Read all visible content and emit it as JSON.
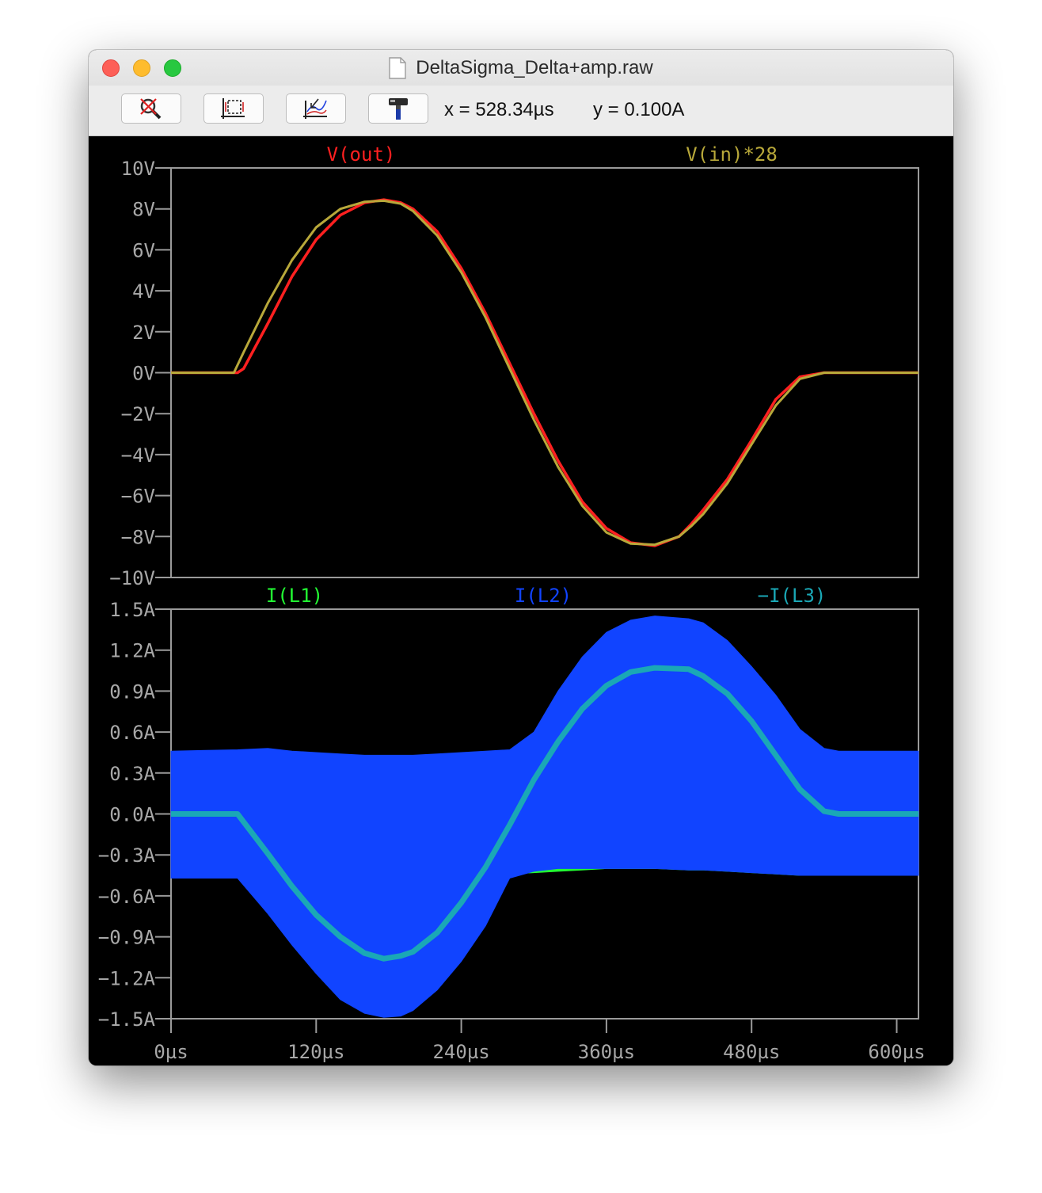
{
  "window": {
    "title": "DeltaSigma_Delta+amp.raw"
  },
  "toolbar": {
    "buttons": [
      {
        "name": "zoom-cancel-button",
        "icon": "zoom-cancel-icon"
      },
      {
        "name": "autorange-button",
        "icon": "autorange-icon"
      },
      {
        "name": "add-plot-button",
        "icon": "add-plot-icon"
      },
      {
        "name": "hammer-button",
        "icon": "hammer-icon"
      }
    ],
    "x_readout": "x = 528.34µs",
    "y_readout": "y = 0.100A"
  },
  "colors": {
    "background": "#000000",
    "grid": "#9a9a9a",
    "axis_text": "#a8a8a8",
    "vout": "#ff2020",
    "vin": "#b8a83a",
    "il1": "#22ff33",
    "il2": "#1144ff",
    "il3": "#1aa8b6"
  },
  "chart_data": [
    {
      "type": "line",
      "legend": [
        "V(out)",
        "V(in)*28"
      ],
      "ylim": [
        -10,
        10
      ],
      "xlim": [
        0,
        600
      ],
      "yticks": [
        "10V",
        "8V",
        "6V",
        "4V",
        "2V",
        "0V",
        "−2V",
        "−4V",
        "−6V",
        "−8V",
        "−10V"
      ],
      "series": [
        {
          "name": "V(out)",
          "x": [
            0,
            52,
            55,
            60,
            80,
            100,
            120,
            140,
            160,
            176,
            190,
            200,
            220,
            240,
            260,
            280,
            300,
            320,
            340,
            360,
            380,
            400,
            420,
            430,
            440,
            460,
            480,
            500,
            520,
            540,
            550,
            552,
            560,
            600,
            618
          ],
          "values": [
            0,
            0,
            0,
            0.2,
            2.4,
            4.7,
            6.5,
            7.7,
            8.3,
            8.45,
            8.3,
            8.0,
            6.9,
            5.1,
            2.9,
            0.45,
            -2.0,
            -4.3,
            -6.3,
            -7.6,
            -8.3,
            -8.45,
            -8.0,
            -7.4,
            -6.7,
            -5.2,
            -3.3,
            -1.3,
            -0.2,
            0,
            0,
            0,
            0,
            0,
            0
          ]
        },
        {
          "name": "V(in)*28",
          "x": [
            0,
            52,
            60,
            80,
            100,
            120,
            140,
            160,
            176,
            190,
            200,
            220,
            240,
            260,
            280,
            300,
            320,
            340,
            360,
            380,
            400,
            420,
            430,
            440,
            460,
            480,
            500,
            520,
            540,
            551,
            560,
            600,
            618
          ],
          "values": [
            0,
            0,
            1.0,
            3.4,
            5.5,
            7.1,
            8.0,
            8.35,
            8.4,
            8.25,
            7.9,
            6.7,
            4.9,
            2.7,
            0.2,
            -2.3,
            -4.6,
            -6.5,
            -7.8,
            -8.35,
            -8.4,
            -8.0,
            -7.5,
            -6.9,
            -5.4,
            -3.5,
            -1.6,
            -0.3,
            0,
            0,
            0,
            0,
            0
          ]
        }
      ]
    },
    {
      "type": "line",
      "legend": [
        "I(L1)",
        "I(L2)",
        "−I(L3)"
      ],
      "ylim": [
        -1.5,
        1.5
      ],
      "xlim": [
        0,
        600
      ],
      "yticks": [
        "1.5A",
        "1.2A",
        "0.9A",
        "0.6A",
        "0.3A",
        "0.0A",
        "−0.3A",
        "−0.6A",
        "−0.9A",
        "−1.2A",
        "−1.5A"
      ],
      "xticks": [
        "0µs",
        "120µs",
        "240µs",
        "360µs",
        "480µs",
        "600µs"
      ],
      "xtick_values": [
        0,
        120,
        240,
        360,
        480,
        600
      ],
      "series": [
        {
          "name": "−I(L3)",
          "x": [
            0,
            55,
            80,
            100,
            120,
            140,
            160,
            176,
            190,
            200,
            220,
            240,
            260,
            280,
            300,
            320,
            340,
            360,
            380,
            400,
            428,
            440,
            460,
            480,
            500,
            520,
            540,
            552,
            560,
            618
          ],
          "values": [
            0,
            0,
            -0.29,
            -0.53,
            -0.74,
            -0.9,
            -1.02,
            -1.06,
            -1.04,
            -1.01,
            -0.87,
            -0.65,
            -0.39,
            -0.08,
            0.25,
            0.53,
            0.77,
            0.94,
            1.04,
            1.07,
            1.06,
            1.01,
            0.88,
            0.68,
            0.43,
            0.18,
            0.02,
            0,
            0,
            0
          ]
        },
        {
          "name": "I(L1)",
          "band_upper": [
            -0.28,
            -0.28,
            -0.57,
            -0.79,
            -1.01,
            -1.2,
            -1.33,
            -1.38,
            -1.37,
            -1.34,
            -1.18,
            -0.95,
            -0.67,
            -0.3,
            -0.29,
            -0.3,
            -0.31,
            -0.31,
            -0.32,
            -0.32,
            -0.32,
            -0.31,
            -0.3,
            -0.29,
            -0.29,
            -0.28,
            -0.28,
            -0.28,
            -0.28,
            -0.28
          ],
          "band_lower": [
            -0.45,
            -0.45,
            -0.69,
            -0.92,
            -1.13,
            -1.32,
            -1.42,
            -1.45,
            -1.44,
            -1.4,
            -1.26,
            -1.04,
            -0.78,
            -0.44,
            -0.43,
            -0.42,
            -0.41,
            -0.4,
            -0.4,
            -0.4,
            -0.41,
            -0.41,
            -0.42,
            -0.43,
            -0.44,
            -0.45,
            -0.45,
            -0.45,
            -0.45,
            -0.45
          ]
        },
        {
          "name": "I(L2)",
          "band_upper": [
            0.46,
            0.47,
            0.48,
            0.46,
            0.45,
            0.44,
            0.43,
            0.43,
            0.43,
            0.43,
            0.44,
            0.45,
            0.46,
            0.47,
            0.6,
            0.9,
            1.15,
            1.33,
            1.42,
            1.45,
            1.43,
            1.4,
            1.27,
            1.08,
            0.87,
            0.62,
            0.48,
            0.46,
            0.46,
            0.46
          ],
          "band_lower": [
            -0.47,
            -0.47,
            -0.73,
            -0.96,
            -1.17,
            -1.36,
            -1.46,
            -1.49,
            -1.48,
            -1.44,
            -1.29,
            -1.08,
            -0.82,
            -0.47,
            -0.42,
            -0.4,
            -0.4,
            -0.4,
            -0.4,
            -0.4,
            -0.41,
            -0.41,
            -0.42,
            -0.43,
            -0.44,
            -0.45,
            -0.45,
            -0.45,
            -0.45,
            -0.45
          ]
        }
      ]
    }
  ]
}
